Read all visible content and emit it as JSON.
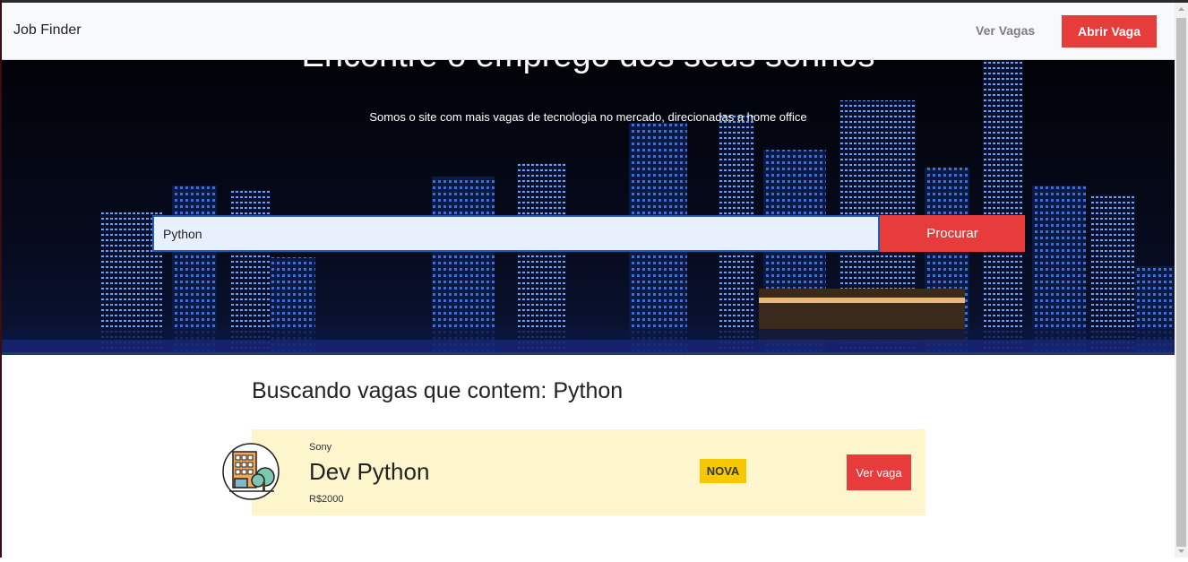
{
  "navbar": {
    "brand": "Job Finder",
    "link_label": "Ver Vagas",
    "cta_label": "Abrir Vaga"
  },
  "hero": {
    "title": "Encontre o emprego dos seus sonhos",
    "subtitle": "Somos o site com mais vagas de tecnologia no mercado, direcionadas a home office",
    "search_value": "Python",
    "search_button": "Procurar"
  },
  "results": {
    "heading": "Buscando vagas que contem: Python",
    "jobs": [
      {
        "company": "Sony",
        "title": "Dev Python",
        "salary": "R$2000",
        "badge": "NOVA",
        "button": "Ver vaga",
        "icon": "building-tree-icon"
      }
    ]
  },
  "colors": {
    "accent": "#e63c3c",
    "badge": "#f5c800",
    "card_bg": "#fdf5cc",
    "hero_bg": "#04060f"
  }
}
